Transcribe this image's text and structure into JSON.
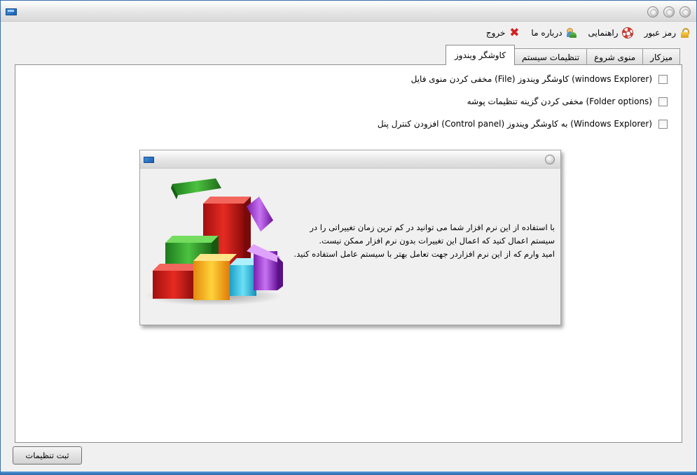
{
  "menu": {
    "items": [
      {
        "label": "رمز عبور",
        "icon": "lock-icon"
      },
      {
        "label": "راهنمایی",
        "icon": "lifebuoy-icon"
      },
      {
        "label": "درباره ما",
        "icon": "users-icon"
      },
      {
        "label": "خروج",
        "icon": "close-x-icon"
      }
    ]
  },
  "tabs": [
    {
      "label": "میزکار",
      "active": false
    },
    {
      "label": "منوی شروع",
      "active": false
    },
    {
      "label": "تنظیمات سیستم",
      "active": false
    },
    {
      "label": "کاوشگر ویندوز",
      "active": true
    }
  ],
  "options": [
    {
      "label": "مخفی کردن منوی فایل (File) کاوشگر ویندوز (windows Explorer)",
      "checked": false
    },
    {
      "label": "مخفی کردن گزینه تنظیمات پوشه (Folder options)",
      "checked": false
    },
    {
      "label": "افزودن کنترل پنل (Control panel) به کاوشگر ویندوز (Windows Explorer)",
      "checked": false
    }
  ],
  "info": {
    "line1": "با استفاده از این نرم افزار شما می توانید در کم ترین زمان تغییراتی را در",
    "line2": "سیستم اعمال کنید که اعمال این تغییرات بدون نرم افزار ممکن نیست.",
    "line3": "امید وارم که از این نرم افزاردر جهت تعامل بهتر با سیستم عامل استفاده کنید."
  },
  "footer": {
    "save_label": "ثبت تنظیمات"
  },
  "colors": {
    "titlebar": "#e6e6e6",
    "panel": "#ffffff",
    "window_bg": "#f0f0f0",
    "accent_blue": "#2c6fb8"
  }
}
